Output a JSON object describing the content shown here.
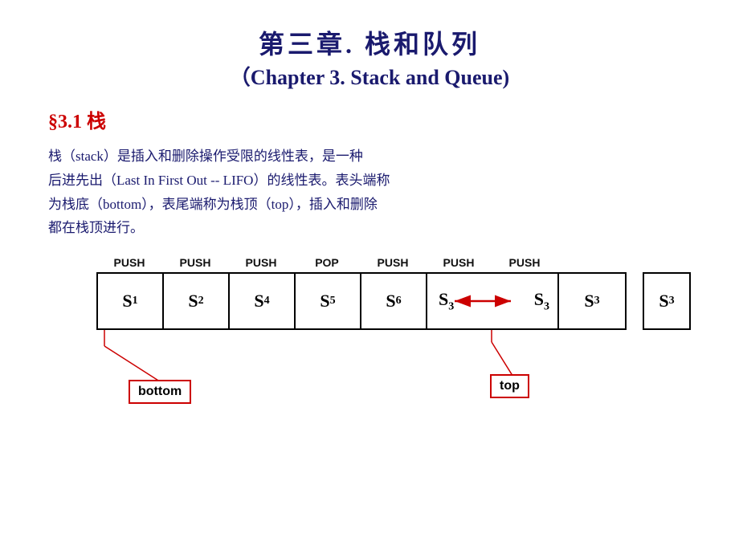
{
  "title": {
    "zh": "第三章. 栈和队列",
    "en": "（Chapter 3.   Stack and Queue)"
  },
  "section": "§3.1  栈",
  "body": {
    "line1": "    栈（stack）是插入和删除操作受限的线性表，是一种",
    "line2": "后进先出（Last In First Out -- LIFO）的线性表。表头端称",
    "line3": "为栈底（bottom），表尾端称为栈顶（top），插入和删除",
    "line4": "都在栈顶进行。"
  },
  "push_labels": [
    "PUSH",
    "PUSH",
    "PUSH",
    "POP",
    "PUSH",
    "PUSH",
    "PUSH"
  ],
  "cells": [
    "S₁",
    "S₂",
    "S₄",
    "S₅",
    "S₆",
    "S₃",
    "S₃",
    "S₃"
  ],
  "standalone": "S₃",
  "bottom_label": "bottom",
  "top_label": "top"
}
